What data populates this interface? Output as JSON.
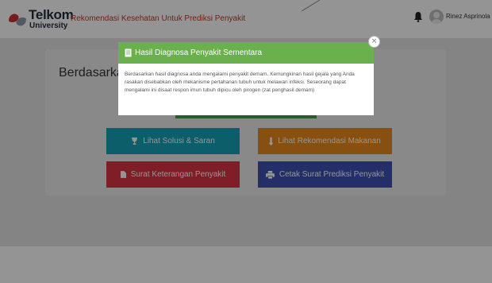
{
  "header": {
    "logo_line1": "Telkom",
    "logo_line2": "University",
    "app_title": "Rekomendasi Kesehatan Untuk Prediksi Penyakit",
    "user_name": "Rinez Asprinola",
    "bell_icon": "bell-icon",
    "avatar_icon": "user-avatar-icon"
  },
  "main": {
    "heading_partial": "Berdasarka",
    "buttons": {
      "solusi": {
        "label": "Lihat Solusi & Saran",
        "icon": "trophy-icon",
        "color": "#17a2b8"
      },
      "makanan": {
        "label": "Lihat Rekomendasi Makanan",
        "icon": "thermometer-icon",
        "color": "#e8891c"
      },
      "surat": {
        "label": "Surat Keterangan Penyakit",
        "icon": "file-icon",
        "color": "#dc3545"
      },
      "cetak": {
        "label": "Cetak Surat Prediksi Penyakit",
        "icon": "print-icon",
        "color": "#3f51b5"
      }
    }
  },
  "modal": {
    "title": "Hasil Diagnosa Penyakit Sementara",
    "title_icon": "document-icon",
    "body": "Berdasarkan hasil diagnosa anda mengalami penyakit demam. Kemungkinan hasil gejala yang Anda rasakan disebabkan oleh mekanisme pertahanan tubuh untuk melawan infeksi. Seseorang dapat mengalami ini disaat respon imun tubuh dipicu oleh pirogen (zat penghasil demam)",
    "close_glyph": "×",
    "header_color": "#6ab04c"
  }
}
